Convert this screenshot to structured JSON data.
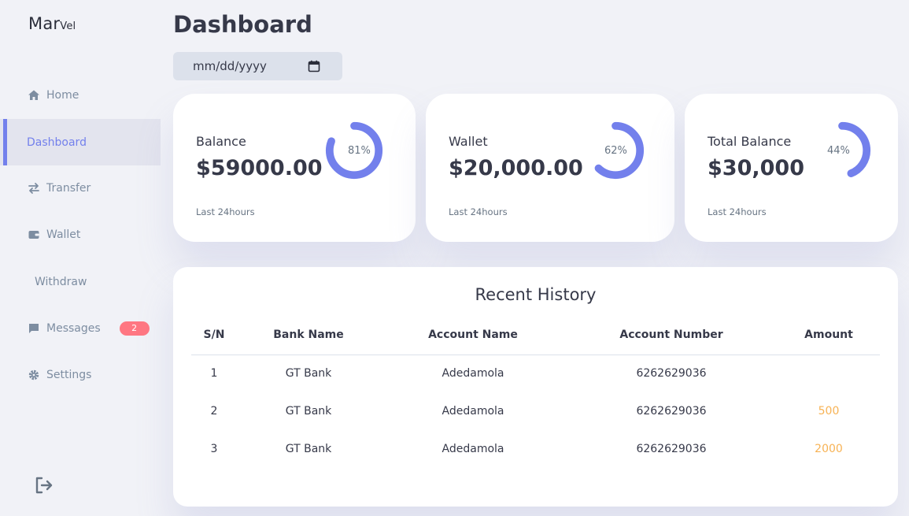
{
  "logo": {
    "main": "Mar",
    "small": "Vel"
  },
  "sidebar": {
    "items": [
      {
        "label": "Home"
      },
      {
        "label": "Dashboard"
      },
      {
        "label": "Transfer"
      },
      {
        "label": "Wallet"
      },
      {
        "label": "Withdraw"
      },
      {
        "label": "Messages",
        "badge": "2"
      },
      {
        "label": "Settings"
      }
    ],
    "active": "Dashboard"
  },
  "header": {
    "title": "Dashboard"
  },
  "date_filter": {
    "placeholder": "mm/dd/yyyy"
  },
  "cards": [
    {
      "label": "Balance",
      "value": "$59000.00",
      "percent_text": "81%",
      "percent": 0.81,
      "note": "Last 24hours"
    },
    {
      "label": "Wallet",
      "value": "$20,000.00",
      "percent_text": "62%",
      "percent": 0.62,
      "note": "Last 24hours"
    },
    {
      "label": "Total Balance",
      "value": "$30,000",
      "percent_text": "44%",
      "percent": 0.44,
      "note": "Last 24hours"
    }
  ],
  "history": {
    "title": "Recent History",
    "columns": [
      "S/N",
      "Bank Name",
      "Account Name",
      "Account Number",
      "Amount"
    ],
    "rows": [
      [
        "1",
        "GT Bank",
        "Adedamola",
        "6262629036",
        ""
      ],
      [
        "2",
        "GT Bank",
        "Adedamola",
        "6262629036",
        "500"
      ],
      [
        "3",
        "GT Bank",
        "Adedamola",
        "6262629036",
        "2000"
      ]
    ]
  },
  "colors": {
    "primary": "#7380ec",
    "danger": "#ff7782",
    "warning": "#f7b254",
    "background": "#f1f2f7"
  }
}
